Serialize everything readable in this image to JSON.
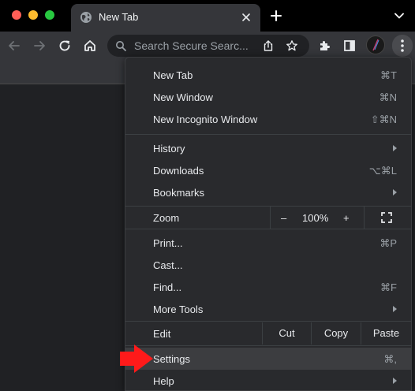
{
  "tab": {
    "title": "New Tab"
  },
  "omnibox": {
    "placeholder": "Search Secure Searc..."
  },
  "menu": {
    "new_tab": {
      "label": "New Tab",
      "shortcut": "⌘T"
    },
    "new_window": {
      "label": "New Window",
      "shortcut": "⌘N"
    },
    "new_incognito": {
      "label": "New Incognito Window",
      "shortcut": "⇧⌘N"
    },
    "history": {
      "label": "History"
    },
    "downloads": {
      "label": "Downloads",
      "shortcut": "⌥⌘L"
    },
    "bookmarks": {
      "label": "Bookmarks"
    },
    "zoom": {
      "label": "Zoom",
      "minus": "–",
      "value": "100%",
      "plus": "+"
    },
    "print": {
      "label": "Print...",
      "shortcut": "⌘P"
    },
    "cast": {
      "label": "Cast..."
    },
    "find": {
      "label": "Find...",
      "shortcut": "⌘F"
    },
    "more_tools": {
      "label": "More Tools"
    },
    "edit": {
      "label": "Edit",
      "cut": "Cut",
      "copy": "Copy",
      "paste": "Paste"
    },
    "settings": {
      "label": "Settings",
      "shortcut": "⌘,"
    },
    "help": {
      "label": "Help"
    }
  },
  "colors": {
    "menu_bg": "#292a2d",
    "toolbar_bg": "#35363a",
    "annotation": "#ff1a1a"
  },
  "icons": [
    "globe-icon",
    "close-icon",
    "plus-icon",
    "chevron-down-icon",
    "back-icon",
    "forward-icon",
    "reload-icon",
    "home-icon",
    "search-icon",
    "share-icon",
    "star-icon",
    "extensions-icon",
    "sidepanel-icon",
    "profile-icon",
    "menu-icon",
    "fullscreen-icon"
  ]
}
